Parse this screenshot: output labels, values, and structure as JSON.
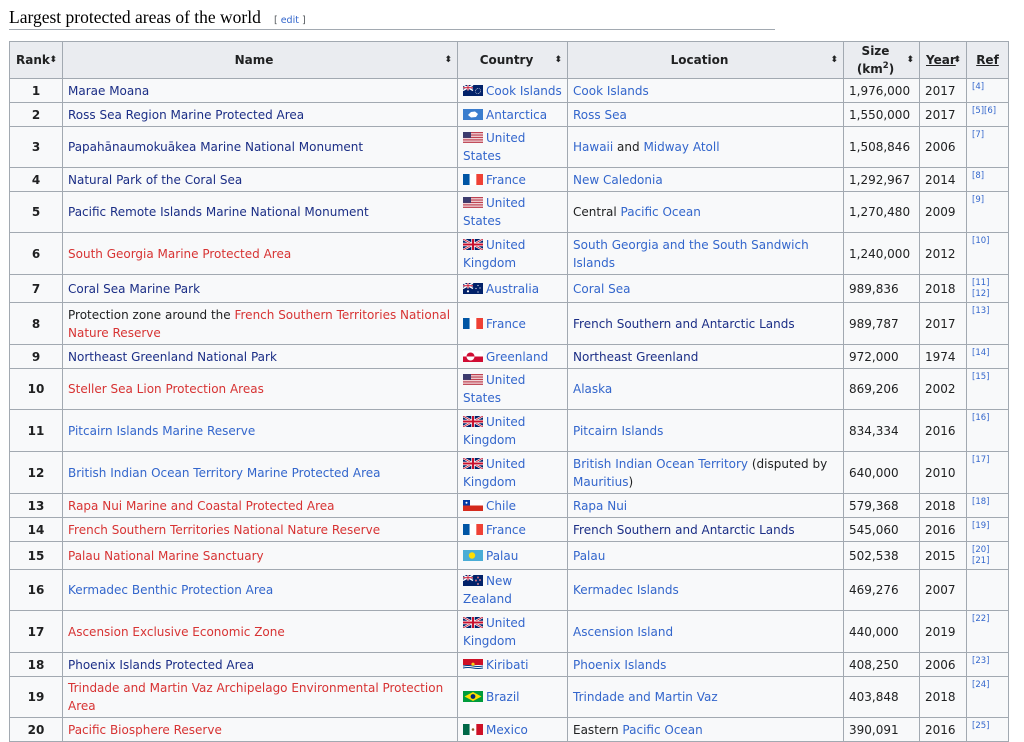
{
  "section": {
    "title": "Largest protected areas of the world",
    "edit": "edit"
  },
  "headers": {
    "rank": "Rank",
    "name": "Name",
    "country": "Country",
    "location": "Location",
    "size": "Size",
    "size_unit": "(km",
    "size_sup": "2",
    "size_close": ")",
    "year": "Year",
    "ref": "Ref"
  },
  "rows": [
    {
      "rank": "1",
      "name": "Marae Moana",
      "nameColor": "dark",
      "country": "Cook Islands",
      "flag": "cook",
      "loc": [
        {
          "t": "Cook Islands",
          "c": "link"
        }
      ],
      "size": "1,976,000",
      "year": "2017",
      "ref": "[4]"
    },
    {
      "rank": "2",
      "name": "Ross Sea Region Marine Protected Area",
      "nameColor": "dark",
      "country": "Antarctica",
      "flag": "antarctica",
      "loc": [
        {
          "t": "Ross Sea",
          "c": "link"
        }
      ],
      "size": "1,550,000",
      "year": "2017",
      "ref": "[5][6]"
    },
    {
      "rank": "3",
      "name": "Papahānaumokuākea Marine National Monument",
      "nameColor": "dark",
      "country": "United States",
      "flag": "us",
      "loc": [
        {
          "t": "Hawaii",
          "c": "link"
        },
        {
          "t": " and ",
          "c": "text"
        },
        {
          "t": "Midway Atoll",
          "c": "link"
        }
      ],
      "size": "1,508,846",
      "year": "2006",
      "ref": "[7]"
    },
    {
      "rank": "4",
      "name": "Natural Park of the Coral Sea",
      "nameColor": "dark",
      "country": "France",
      "flag": "fr",
      "loc": [
        {
          "t": "New Caledonia",
          "c": "link"
        }
      ],
      "size": "1,292,967",
      "year": "2014",
      "ref": "[8]"
    },
    {
      "rank": "5",
      "name": "Pacific Remote Islands Marine National Monument",
      "nameColor": "dark",
      "country": "United States",
      "flag": "us",
      "loc": [
        {
          "t": "Central ",
          "c": "text"
        },
        {
          "t": "Pacific Ocean",
          "c": "link"
        }
      ],
      "size": "1,270,480",
      "year": "2009",
      "ref": "[9]"
    },
    {
      "rank": "6",
      "name": "South Georgia Marine Protected Area",
      "nameColor": "red",
      "country": "United Kingdom",
      "flag": "uk",
      "loc": [
        {
          "t": "South Georgia and the South Sandwich Islands",
          "c": "link"
        }
      ],
      "size": "1,240,000",
      "year": "2012",
      "ref": "[10]"
    },
    {
      "rank": "7",
      "name": "Coral Sea Marine Park",
      "nameColor": "dark",
      "country": "Australia",
      "flag": "au",
      "loc": [
        {
          "t": "Coral Sea",
          "c": "link"
        }
      ],
      "size": "989,836",
      "year": "2018",
      "ref": "[11][12]"
    },
    {
      "rank": "8",
      "namePrefix": "Protection zone around the ",
      "name": "French Southern Territories National Nature Reserve",
      "nameColor": "red",
      "country": "France",
      "flag": "fr",
      "loc": [
        {
          "t": "French Southern and Antarctic Lands",
          "c": "dark"
        }
      ],
      "size": "989,787",
      "year": "2017",
      "ref": "[13]"
    },
    {
      "rank": "9",
      "name": "Northeast Greenland National Park",
      "nameColor": "dark",
      "country": "Greenland",
      "flag": "gl",
      "loc": [
        {
          "t": "Northeast Greenland",
          "c": "dark"
        }
      ],
      "size": "972,000",
      "year": "1974",
      "ref": "[14]"
    },
    {
      "rank": "10",
      "name": "Steller Sea Lion Protection Areas",
      "nameColor": "red",
      "country": "United States",
      "flag": "us",
      "loc": [
        {
          "t": "Alaska",
          "c": "link"
        }
      ],
      "size": "869,206",
      "year": "2002",
      "ref": "[15]"
    },
    {
      "rank": "11",
      "name": "Pitcairn Islands Marine Reserve",
      "nameColor": "link",
      "country": "United Kingdom",
      "flag": "uk",
      "loc": [
        {
          "t": "Pitcairn Islands",
          "c": "link"
        }
      ],
      "size": "834,334",
      "year": "2016",
      "ref": "[16]"
    },
    {
      "rank": "12",
      "name": "British Indian Ocean Territory Marine Protected Area",
      "nameColor": "link",
      "country": "United Kingdom",
      "flag": "uk",
      "loc": [
        {
          "t": "British Indian Ocean Territory",
          "c": "link"
        },
        {
          "t": " (disputed by ",
          "c": "text"
        },
        {
          "t": "Mauritius",
          "c": "link"
        },
        {
          "t": ")",
          "c": "text"
        }
      ],
      "size": "640,000",
      "year": "2010",
      "ref": "[17]"
    },
    {
      "rank": "13",
      "name": "Rapa Nui Marine and Coastal Protected Area",
      "nameColor": "red",
      "country": "Chile",
      "flag": "cl",
      "loc": [
        {
          "t": "Rapa Nui",
          "c": "link"
        }
      ],
      "size": "579,368",
      "year": "2018",
      "ref": "[18]"
    },
    {
      "rank": "14",
      "name": "French Southern Territories National Nature Reserve",
      "nameColor": "red",
      "country": "France",
      "flag": "fr",
      "loc": [
        {
          "t": "French Southern and Antarctic Lands",
          "c": "dark"
        }
      ],
      "size": "545,060",
      "year": "2016",
      "ref": "[19]"
    },
    {
      "rank": "15",
      "name": "Palau National Marine Sanctuary",
      "nameColor": "red",
      "country": "Palau",
      "flag": "pw",
      "loc": [
        {
          "t": "Palau",
          "c": "link"
        }
      ],
      "size": "502,538",
      "year": "2015",
      "ref": "[20][21]"
    },
    {
      "rank": "16",
      "name": "Kermadec Benthic Protection Area",
      "nameColor": "link",
      "country": "New Zealand",
      "flag": "nz",
      "loc": [
        {
          "t": "Kermadec Islands",
          "c": "link"
        }
      ],
      "size": "469,276",
      "year": "2007",
      "ref": ""
    },
    {
      "rank": "17",
      "name": "Ascension Exclusive Economic Zone",
      "nameColor": "red",
      "country": "United Kingdom",
      "flag": "uk",
      "loc": [
        {
          "t": "Ascension Island",
          "c": "link"
        }
      ],
      "size": "440,000",
      "year": "2019",
      "ref": "[22]"
    },
    {
      "rank": "18",
      "name": "Phoenix Islands Protected Area",
      "nameColor": "dark",
      "country": "Kiribati",
      "flag": "ki",
      "loc": [
        {
          "t": "Phoenix Islands",
          "c": "link"
        }
      ],
      "size": "408,250",
      "year": "2006",
      "ref": "[23]"
    },
    {
      "rank": "19",
      "name": "Trindade and Martin Vaz Archipelago Environmental Protection Area",
      "nameColor": "red",
      "country": "Brazil",
      "flag": "br",
      "loc": [
        {
          "t": "Trindade and Martin Vaz",
          "c": "link"
        }
      ],
      "size": "403,848",
      "year": "2018",
      "ref": "[24]"
    },
    {
      "rank": "20",
      "name": "Pacific Biosphere Reserve",
      "nameColor": "red",
      "country": "Mexico",
      "flag": "mx",
      "loc": [
        {
          "t": "Eastern ",
          "c": "text"
        },
        {
          "t": "Pacific Ocean",
          "c": "link"
        }
      ],
      "size": "390,091",
      "year": "2016",
      "ref": "[25]"
    }
  ],
  "colors": {
    "link": "#3366cc",
    "red": "#d73333",
    "dark": "#1b2e86",
    "header_bg": "#eaecf0",
    "cell_bg": "#f8f9fa",
    "border": "#a2a9b1"
  }
}
